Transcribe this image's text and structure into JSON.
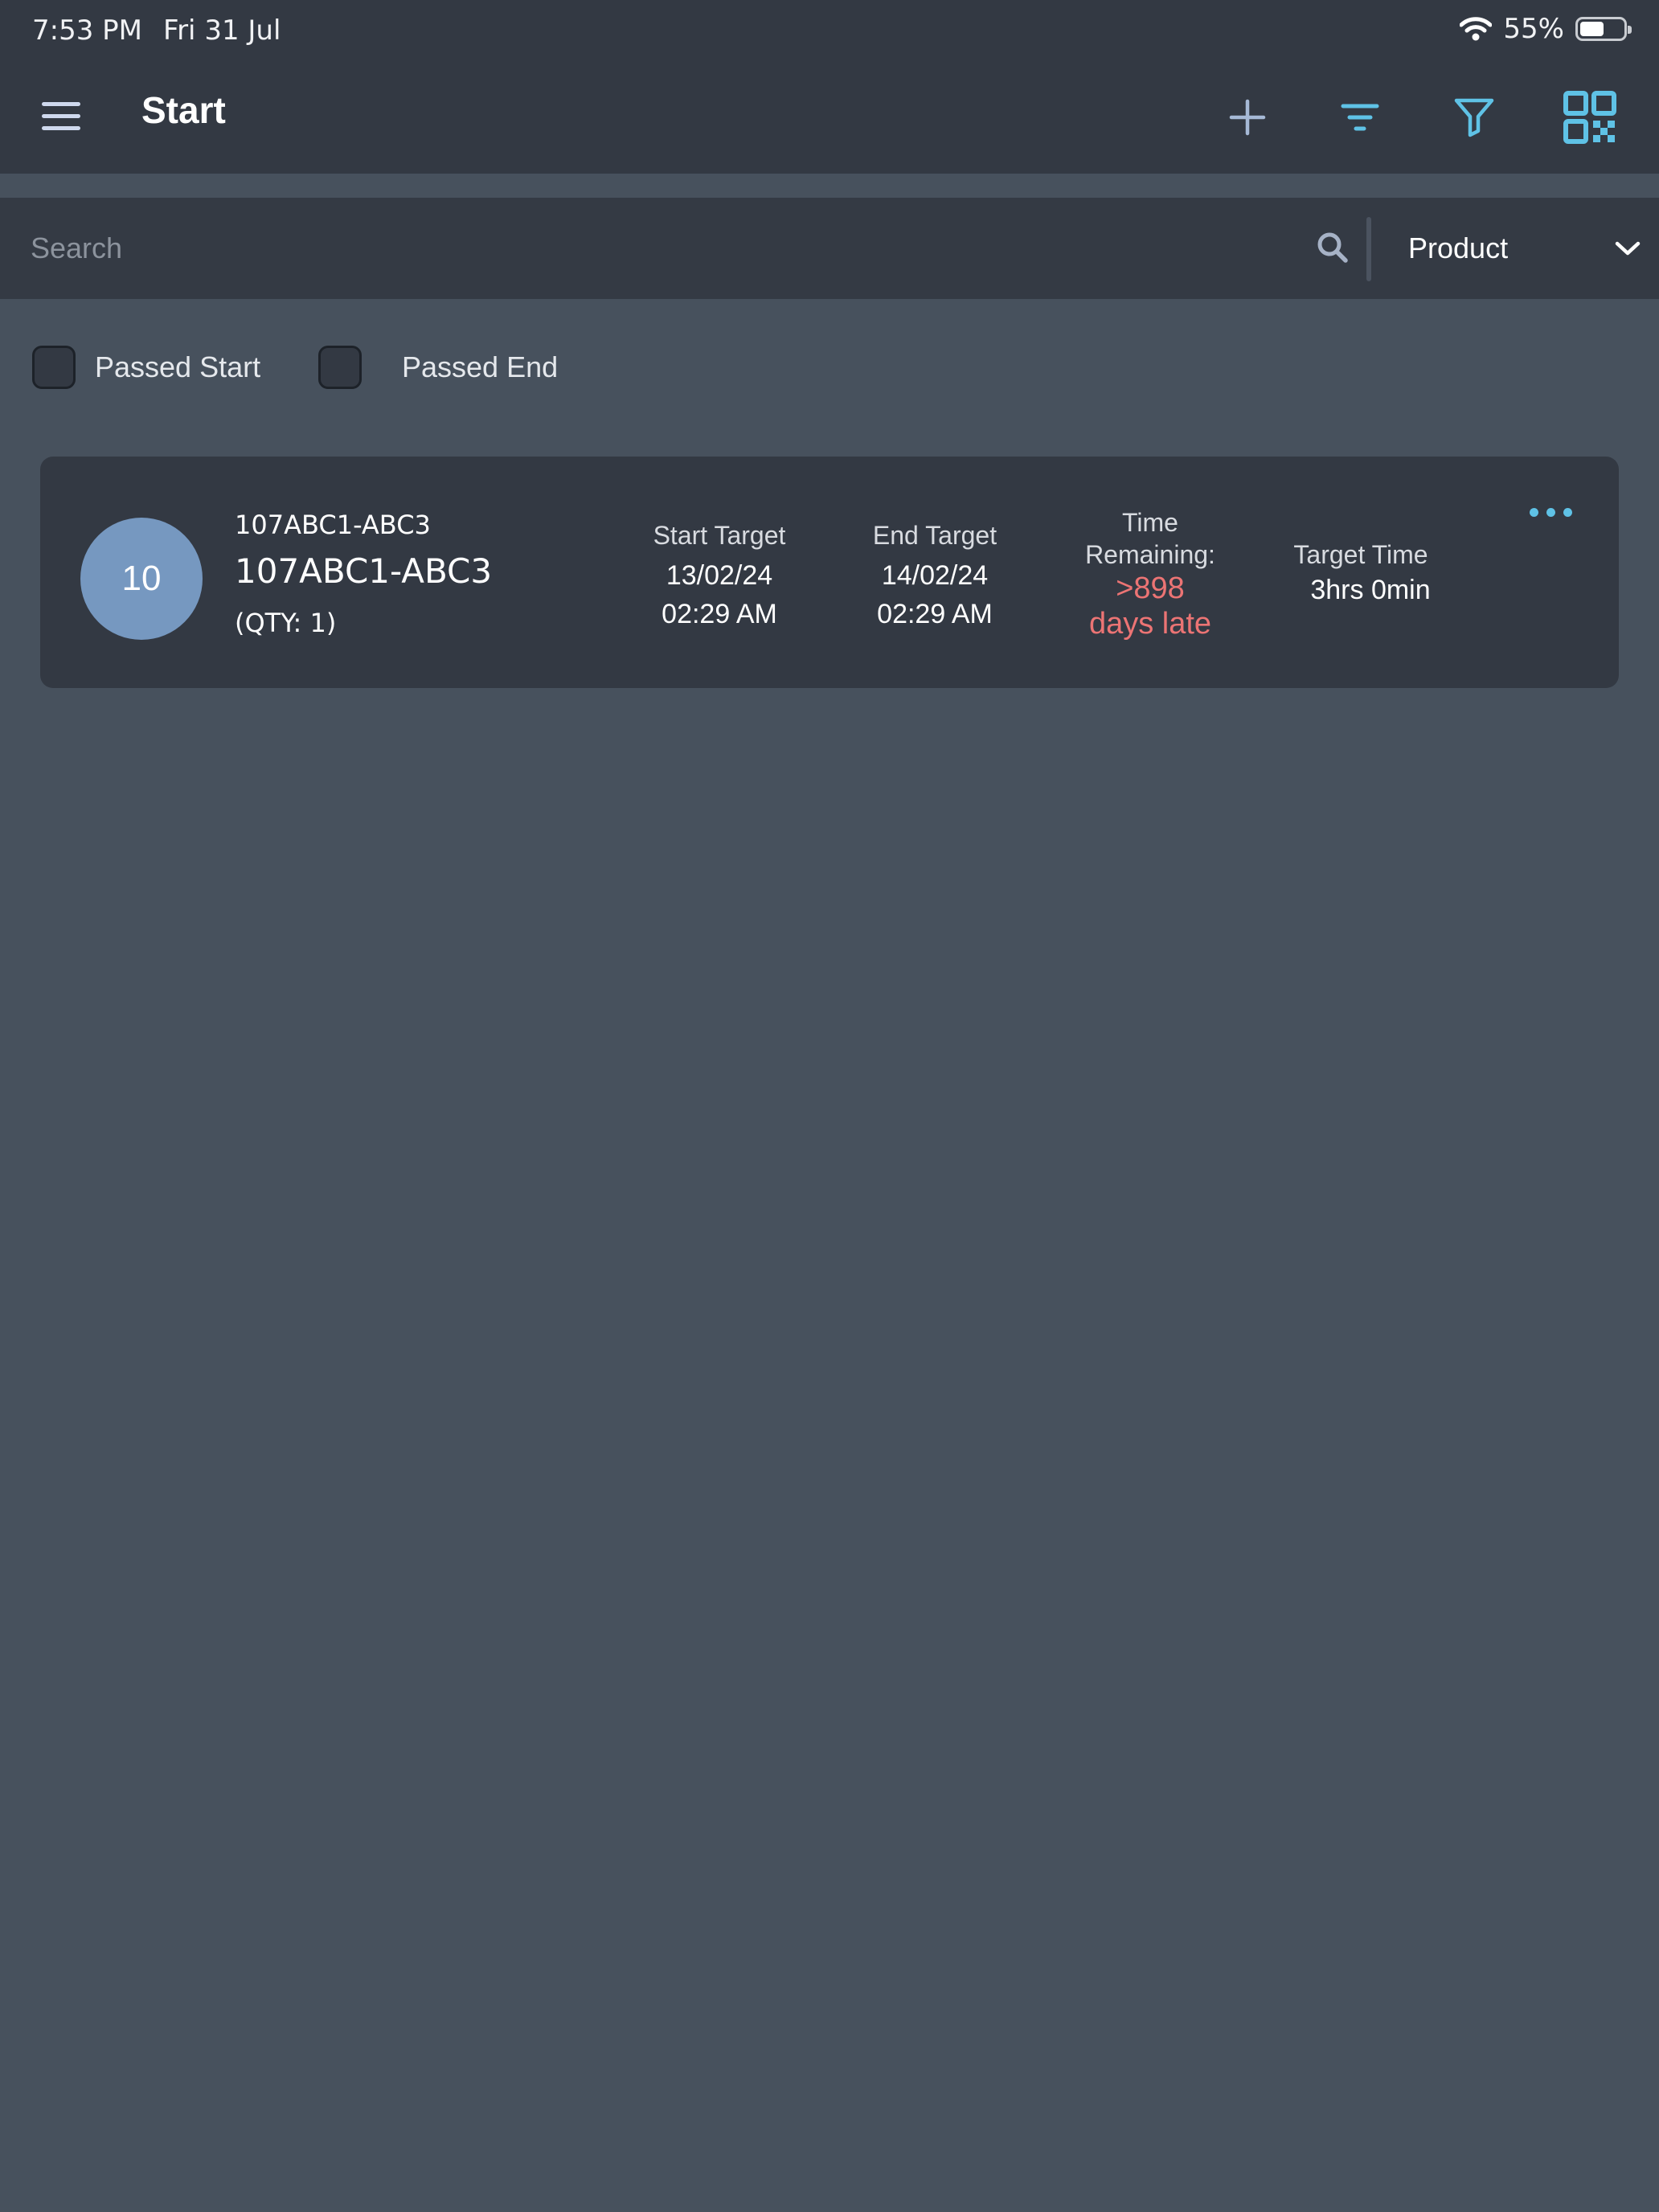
{
  "status_bar": {
    "time": "7:53 PM",
    "date": "Fri 31 Jul",
    "battery": "55%",
    "battery_level": 0.55
  },
  "nav": {
    "title": "Start",
    "icons": [
      "menu-icon",
      "plus-icon",
      "sort-icon",
      "filter-icon",
      "qr-code-icon"
    ],
    "accent_color": "#5fc2e6"
  },
  "search": {
    "placeholder": "Search",
    "category": "Product"
  },
  "filters": {
    "passed_start": "Passed Start",
    "passed_end": "Passed End"
  },
  "job": {
    "avatar_number": "10",
    "code_small": "107ABC1-ABC3",
    "code_large": "107ABC1-ABC3",
    "qty": "(QTY: 1)",
    "start_target_label": "Start Target",
    "start_target_date": "13/02/24",
    "start_target_time": "02:29 AM",
    "end_target_label": "End Target",
    "end_target_date": "14/02/24",
    "end_target_time": "02:29 AM",
    "time_remaining_label_1": "Time",
    "time_remaining_label_2": "Remaining:",
    "time_remaining_value_1": ">898",
    "time_remaining_value_2": "days late",
    "target_time_label": "Target Time",
    "target_time_value": "3hrs 0min",
    "late_color": "#ec7474"
  }
}
